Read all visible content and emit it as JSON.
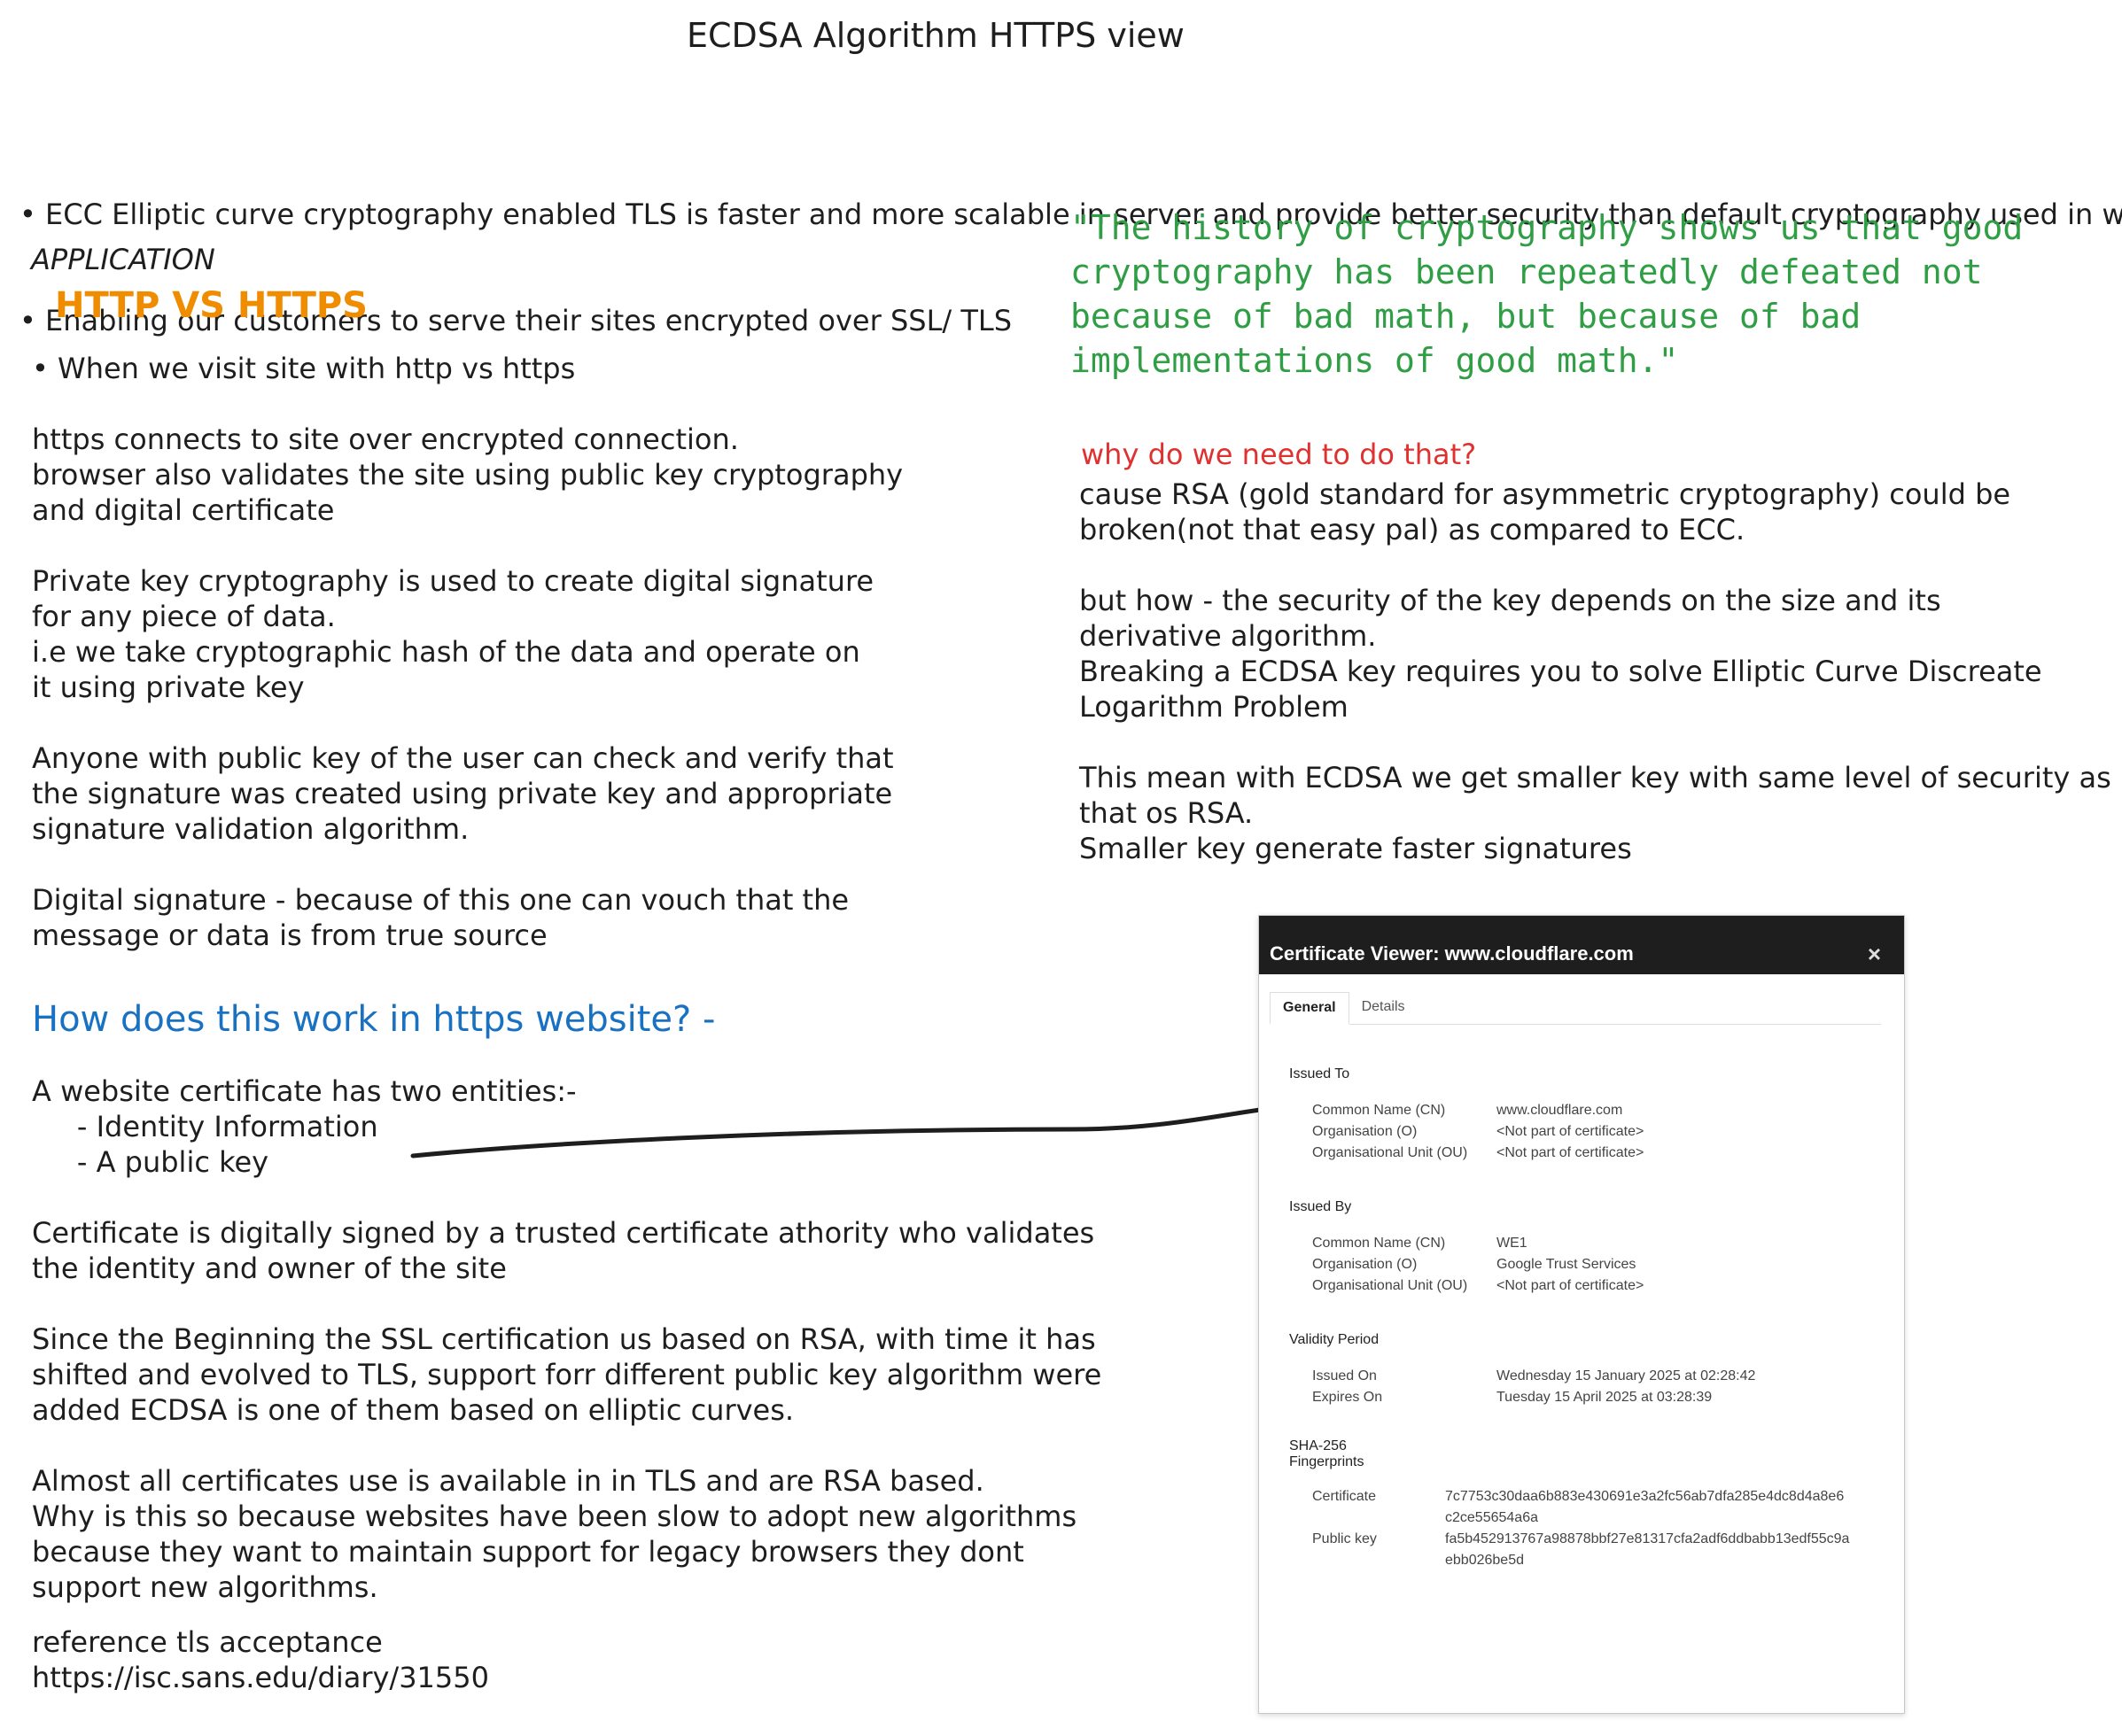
{
  "title": "ECDSA Algorithm HTTPS view",
  "bullets": [
    "• ECC Elliptic curve cryptography enabled TLS is faster and more scalable in server and provide better security than default cryptography used in web",
    "• Enabling our customers to serve their sites encrypted over SSL/ TLS"
  ],
  "left": {
    "application_label": "APPLICATION",
    "http_vs_https": "HTTP VS HTTPS",
    "visit_bullet": "• When we visit site with http vs https",
    "para1": "https connects to site over encrypted connection.\nbrowser also validates the site using public key cryptography\nand digital certificate",
    "para2": "Private key cryptography is used to create digital signature\nfor any piece of data.\ni.e we take cryptographic hash of the data and operate on\nit using private key",
    "para3": "Anyone with public key of the user can check and verify that\nthe signature was created using private key and appropriate\nsignature validation algorithm.",
    "para4": "Digital signature - because of this one can vouch that the\nmessage or data is from true source",
    "how_heading": "How does this work in https website? -",
    "cert_entities": "A website certificate has two entities:-\n     - Identity Information\n     - A public key",
    "para5": "Certificate is digitally signed by a trusted certificate athority who validates\nthe identity and owner of the site",
    "para6": "Since the Beginning the SSL certification us based on RSA, with time it has\nshifted and evolved to TLS, support forr different public key algorithm were\nadded ECDSA is one of them based on elliptic curves.",
    "para7": "Almost all certificates use is available in in TLS and are RSA based.\nWhy is this so because websites have been slow to adopt new algorithms\nbecause they want to maintain support for legacy browsers they dont\nsupport new algorithms.",
    "reference": "reference tls acceptance\nhttps://isc.sans.edu/diary/31550"
  },
  "right": {
    "quote": "\"The history of cryptography shows us that good\ncryptography has been repeatedly defeated not\nbecause of bad math, but because of bad\nimplementations of good math.\"",
    "why_question": "why do we need to do that?",
    "para1": "cause RSA (gold standard for asymmetric cryptography) could be\nbroken(not that easy pal) as compared to ECC.",
    "para2": "but how - the security of the key depends on the size and its\nderivative algorithm.\nBreaking a ECDSA key requires you to solve Elliptic Curve Discreate\nLogarithm Problem",
    "para3": "This mean with ECDSA we get smaller key with same level of security as\nthat os RSA.\nSmaller key generate faster signatures"
  },
  "certificate_viewer": {
    "title": "Certificate Viewer: www.cloudflare.com",
    "close": "×",
    "tabs": [
      "General",
      "Details"
    ],
    "issued_to": {
      "heading": "Issued To",
      "labels": "Common Name (CN)\nOrganisation (O)\nOrganisational Unit (OU)",
      "values": "www.cloudflare.com\n<Not part of certificate>\n<Not part of certificate>"
    },
    "issued_by": {
      "heading": "Issued By",
      "labels": "Common Name (CN)\nOrganisation (O)\nOrganisational Unit (OU)",
      "values": "WE1\nGoogle Trust Services\n<Not part of certificate>"
    },
    "validity": {
      "heading": "Validity Period",
      "labels": "Issued On\nExpires On",
      "values": "Wednesday 15 January 2025 at 02:28:42\nTuesday 15 April 2025 at 03:28:39"
    },
    "fingerprints": {
      "heading": "SHA-256\nFingerprints",
      "certificate_label": "Certificate",
      "certificate_value": "7c7753c30daa6b883e430691e3a2fc56ab7dfa285e4dc8d4a8e6\nc2ce55654a6a",
      "public_key_label": "Public key",
      "public_key_value": "fa5b452913767a98878bbf27e81317cfa2adf6ddbabb13edf55c9a\nebb026be5d"
    }
  }
}
